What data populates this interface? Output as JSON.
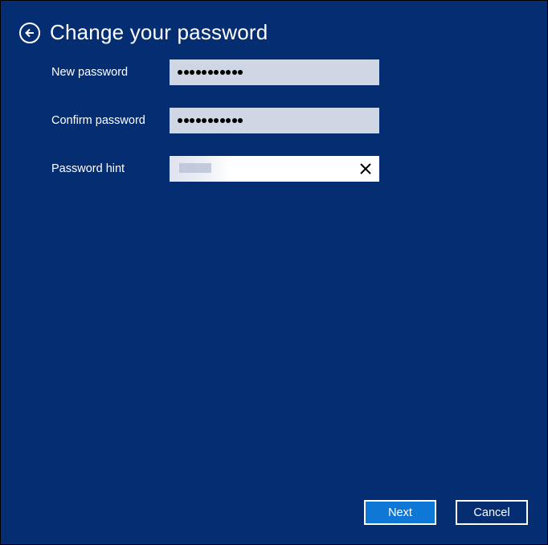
{
  "header": {
    "title": "Change your password",
    "back_icon": "back-arrow-circle-icon"
  },
  "form": {
    "new_password": {
      "label": "New password",
      "masked_length": 11
    },
    "confirm_password": {
      "label": "Confirm password",
      "masked_length": 11
    },
    "password_hint": {
      "label": "Password hint",
      "value_obscured": true,
      "clear_icon": "close-icon"
    }
  },
  "buttons": {
    "next": "Next",
    "cancel": "Cancel"
  },
  "colors": {
    "background": "#052d72",
    "primary_button": "#0f78d7",
    "field_bg": "#cfd6e4"
  }
}
